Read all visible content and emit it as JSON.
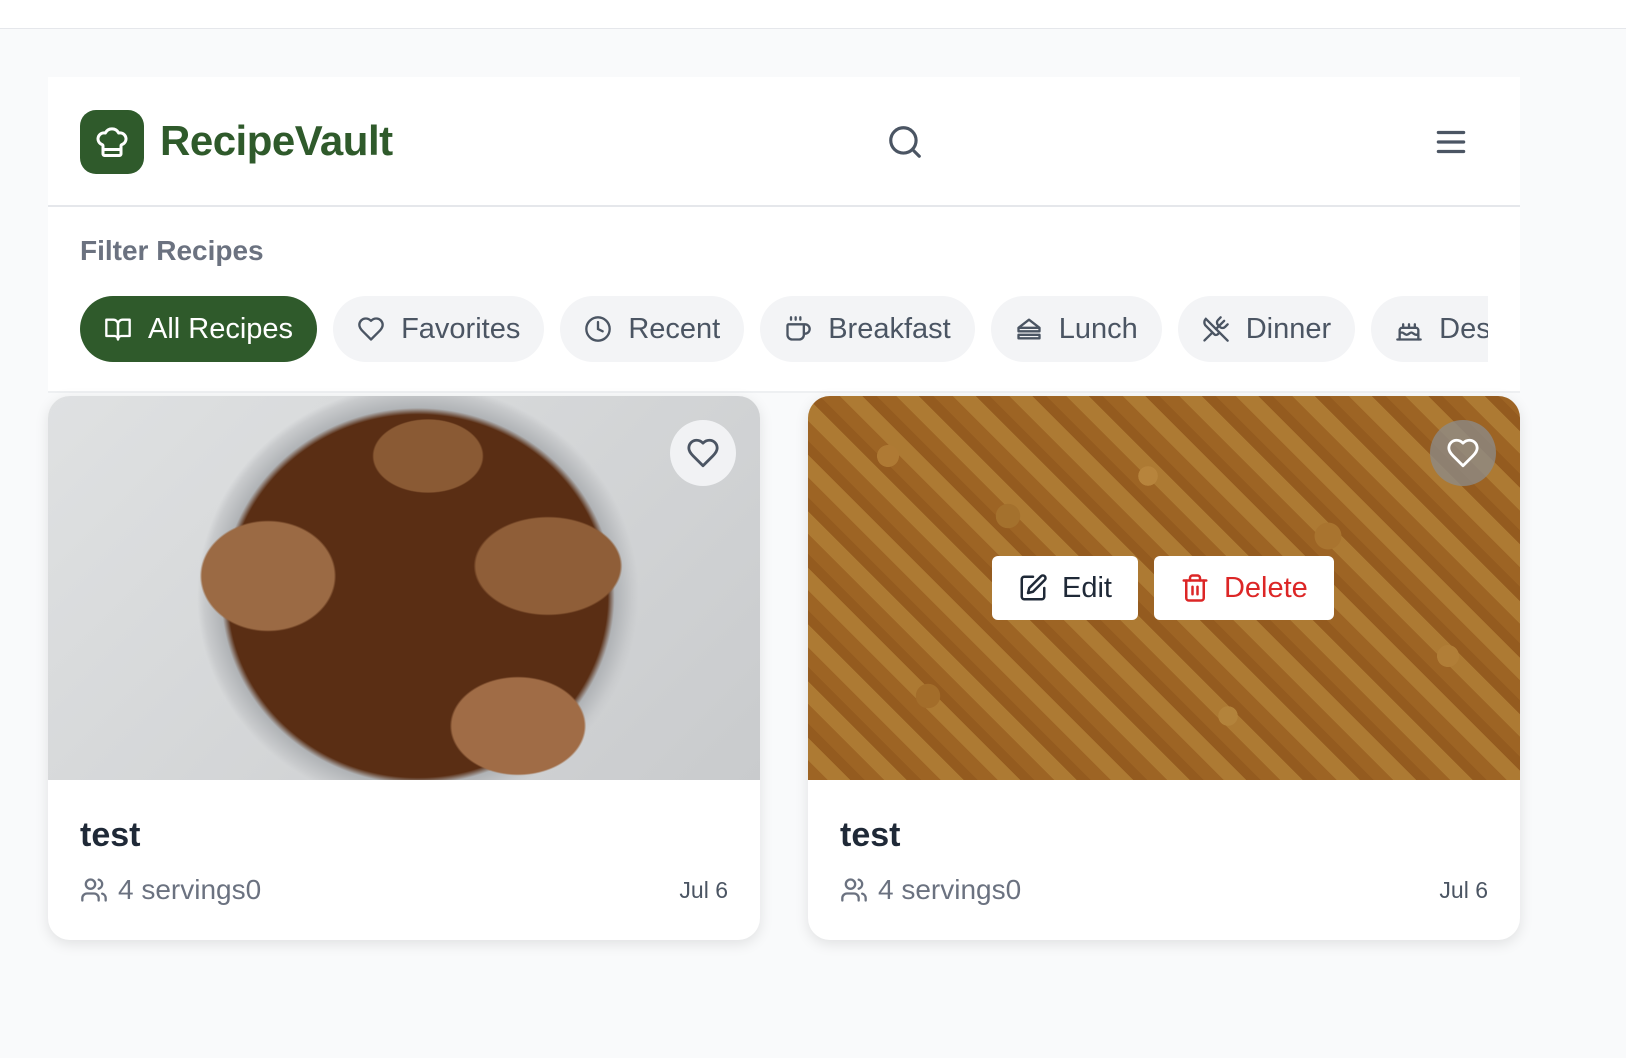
{
  "app": {
    "brand": "RecipeVault"
  },
  "header": {
    "search_icon": "search-icon",
    "menu_icon": "menu-icon"
  },
  "filters": {
    "title": "Filter Recipes",
    "chips": [
      {
        "label": "All Recipes",
        "icon": "book-open-icon",
        "active": true
      },
      {
        "label": "Favorites",
        "icon": "heart-icon",
        "active": false
      },
      {
        "label": "Recent",
        "icon": "clock-icon",
        "active": false
      },
      {
        "label": "Breakfast",
        "icon": "coffee-icon",
        "active": false
      },
      {
        "label": "Lunch",
        "icon": "sandwich-icon",
        "active": false
      },
      {
        "label": "Dinner",
        "icon": "utensils-crossed-icon",
        "active": false
      },
      {
        "label": "Desserts",
        "icon": "cake-icon",
        "active": false
      }
    ]
  },
  "recipes": [
    {
      "title": "test",
      "servings": "4 servings0",
      "date": "Jul 6"
    },
    {
      "title": "test",
      "servings": "4 servings0",
      "date": "Jul 6",
      "actions": {
        "edit": "Edit",
        "delete": "Delete"
      }
    }
  ],
  "colors": {
    "brand": "#2f5a2b",
    "danger": "#dc2626",
    "muted": "#6b7280"
  }
}
